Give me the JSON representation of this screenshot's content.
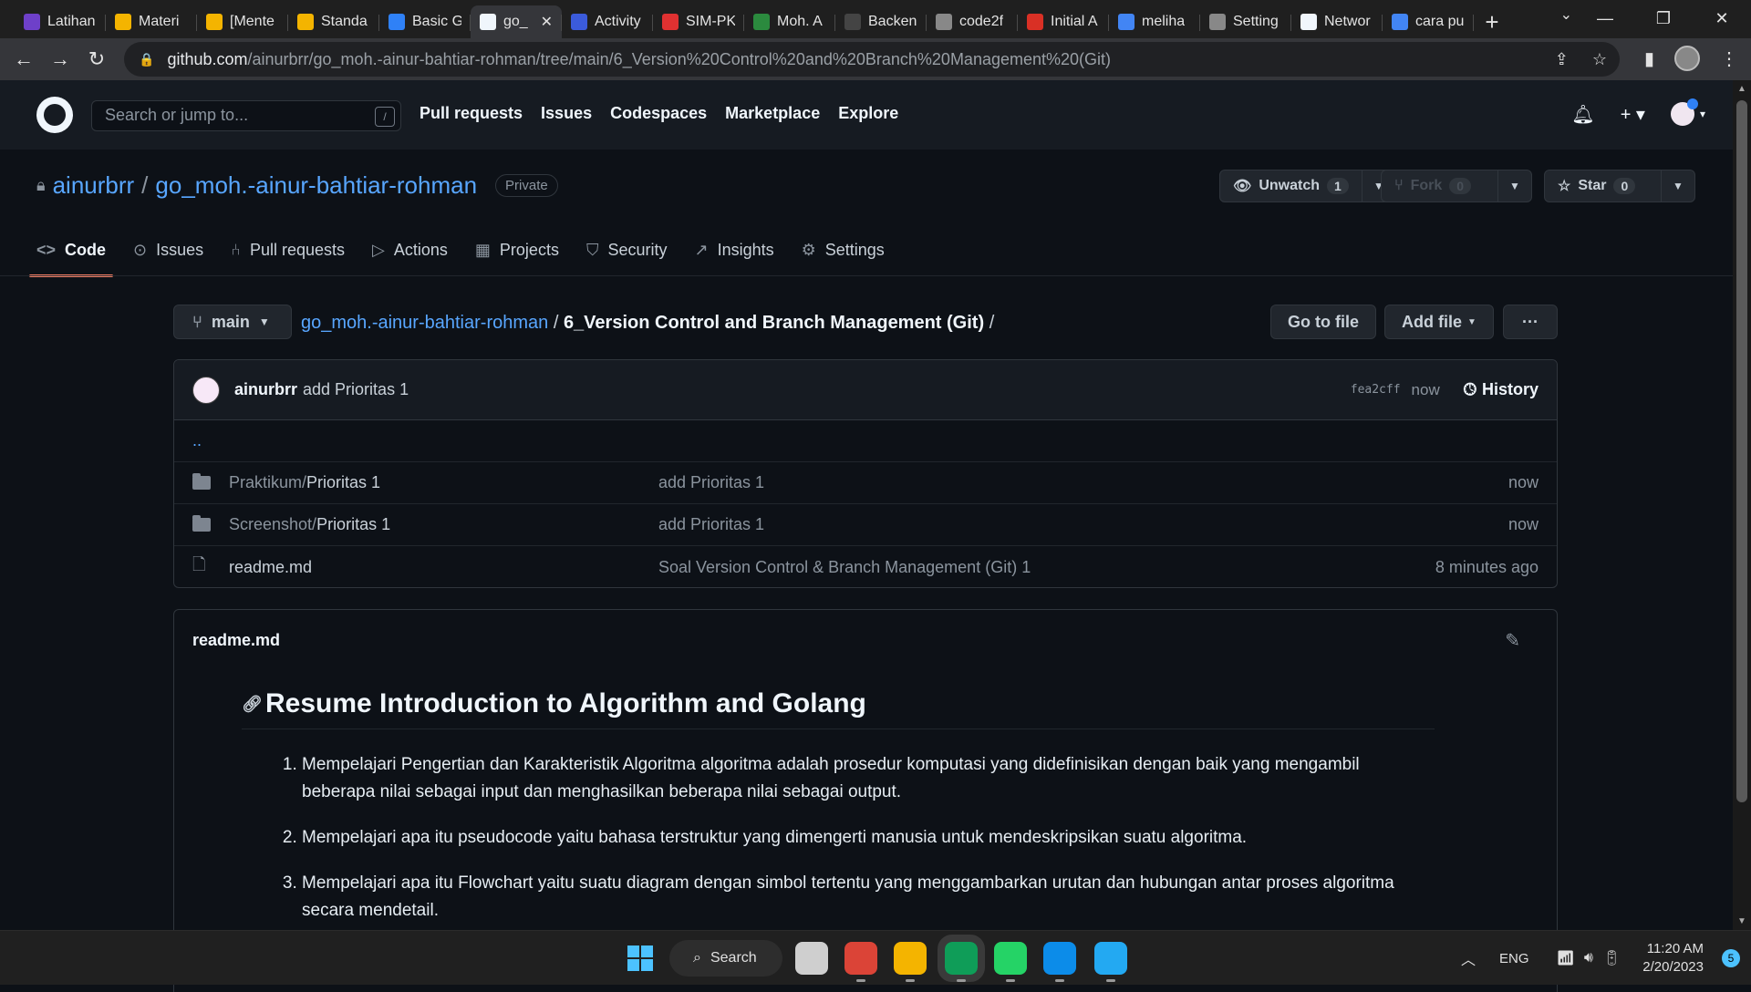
{
  "browser": {
    "tabs": [
      {
        "title": "Latihan",
        "color": "#6e40c9",
        "icon": "dash-icon"
      },
      {
        "title": "Materi",
        "color": "#f4b400",
        "icon": "slides-icon"
      },
      {
        "title": "[Mente",
        "color": "#f4b400",
        "icon": "slides-icon"
      },
      {
        "title": "Standa",
        "color": "#f4b400",
        "icon": "slides-icon"
      },
      {
        "title": "Basic G",
        "color": "#2f81f7",
        "icon": "bookmark-icon"
      },
      {
        "title": "go_",
        "color": "#f0f6fc",
        "icon": "github-icon",
        "active": true
      },
      {
        "title": "Activity",
        "color": "#3b5bdb",
        "icon": "activity-icon"
      },
      {
        "title": "SIM-PK",
        "color": "#e03131",
        "icon": "simpk-icon"
      },
      {
        "title": "Moh. A",
        "color": "#2b8a3e",
        "icon": "moh-icon"
      },
      {
        "title": "Backen",
        "color": "#444444",
        "icon": "backend-icon"
      },
      {
        "title": "code2f",
        "color": "#888888",
        "icon": "globe-icon"
      },
      {
        "title": "Initial A",
        "color": "#d93025",
        "icon": "gmail-icon"
      },
      {
        "title": "meliha",
        "color": "#4285f4",
        "icon": "google-icon"
      },
      {
        "title": "Setting",
        "color": "#888888",
        "icon": "meet-icon"
      },
      {
        "title": "Networ",
        "color": "#f0f6fc",
        "icon": "github-icon"
      },
      {
        "title": "cara pu",
        "color": "#4285f4",
        "icon": "google-icon"
      }
    ],
    "url_host": "github.com",
    "url_path": "/ainurbrr/go_moh.-ainur-bahtiar-rohman/tree/main/6_Version%20Control%20and%20Branch%20Management%20(Git)"
  },
  "github": {
    "search_placeholder": "Search or jump to...",
    "search_key": "/",
    "nav": [
      "Pull requests",
      "Issues",
      "Codespaces",
      "Marketplace",
      "Explore"
    ]
  },
  "repo": {
    "owner": "ainurbrr",
    "name": "go_moh.-ainur-bahtiar-rohman",
    "visibility": "Private",
    "unwatch_label": "Unwatch",
    "watch_count": "1",
    "fork_label": "Fork",
    "fork_count": "0",
    "star_label": "Star",
    "star_count": "0",
    "tabs": [
      "Code",
      "Issues",
      "Pull requests",
      "Actions",
      "Projects",
      "Security",
      "Insights",
      "Settings"
    ]
  },
  "filenav": {
    "branch": "main",
    "repo_link": "go_moh.-ainur-bahtiar-rohman",
    "sep": "/",
    "current_dir": "6_Version Control and Branch Management (Git)",
    "trailing_sep": "/",
    "goto_file": "Go to file",
    "add_file": "Add file",
    "more": "···"
  },
  "commit": {
    "user": "ainurbrr",
    "message": "add Prioritas 1",
    "sha": "fea2cff",
    "time": "now",
    "history_label": "History"
  },
  "files": {
    "parent": "..",
    "rows": [
      {
        "dir": "Praktikum/",
        "name": "Prioritas 1",
        "message": "add Prioritas 1",
        "time": "now",
        "type": "folder"
      },
      {
        "dir": "Screenshot/",
        "name": "Prioritas 1",
        "message": "add Prioritas 1",
        "time": "now",
        "type": "folder"
      },
      {
        "dir": "",
        "name": "readme.md",
        "message": "Soal Version Control & Branch Management (Git) 1",
        "time": "8 minutes ago",
        "type": "file"
      }
    ]
  },
  "readme": {
    "filename": "readme.md",
    "heading": "Resume Introduction to Algorithm and Golang",
    "items": [
      "Mempelajari Pengertian dan Karakteristik Algoritma algoritma adalah prosedur komputasi yang didefinisikan dengan baik yang mengambil beberapa nilai sebagai input dan menghasilkan beberapa nilai sebagai output.",
      "Mempelajari apa itu pseudocode yaitu bahasa terstruktur yang dimengerti manusia untuk mendeskripsikan suatu algoritma.",
      "Mempelajari apa itu Flowchart yaitu suatu diagram dengan simbol tertentu yang menggambarkan urutan dan hubungan antar proses algoritma secara mendetail."
    ]
  },
  "taskbar": {
    "search_label": "Search",
    "language": "ENG",
    "time": "11:20 AM",
    "date": "2/20/2023",
    "notifications": "5",
    "apps": [
      {
        "name": "task-view-icon",
        "color": "#cfcfcf"
      },
      {
        "name": "chrome-icon",
        "color": "#db4437"
      },
      {
        "name": "file-explorer-icon",
        "color": "#f4b400"
      },
      {
        "name": "chrome-profile-icon",
        "color": "#0f9d58"
      },
      {
        "name": "whatsapp-icon",
        "color": "#25d366"
      },
      {
        "name": "edge-icon",
        "color": "#0c8ce9"
      },
      {
        "name": "vscode-icon",
        "color": "#23a9f2"
      }
    ]
  },
  "colors": {
    "accent": "#58a6ff",
    "tab_underline": "#f78166",
    "bg": "#0d1117"
  }
}
